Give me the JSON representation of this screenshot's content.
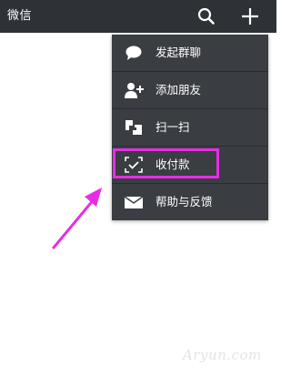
{
  "header": {
    "title": "微信",
    "search_icon": "search-icon",
    "add_icon": "plus-icon"
  },
  "menu": {
    "items": [
      {
        "label": "发起群聊",
        "icon": "chat-bubble-icon"
      },
      {
        "label": "添加朋友",
        "icon": "add-friend-icon"
      },
      {
        "label": "扫一扫",
        "icon": "scan-icon"
      },
      {
        "label": "收付款",
        "icon": "payment-scan-icon"
      },
      {
        "label": "帮助与反馈",
        "icon": "envelope-icon"
      }
    ]
  },
  "annotation": {
    "highlight_color": "#e62ee6",
    "highlighted_item": "收付款"
  },
  "watermark": "Aryun.com",
  "colors": {
    "topbar": "#2e3237",
    "menu_bg": "#3a3d42",
    "accent": "#e62ee6"
  }
}
